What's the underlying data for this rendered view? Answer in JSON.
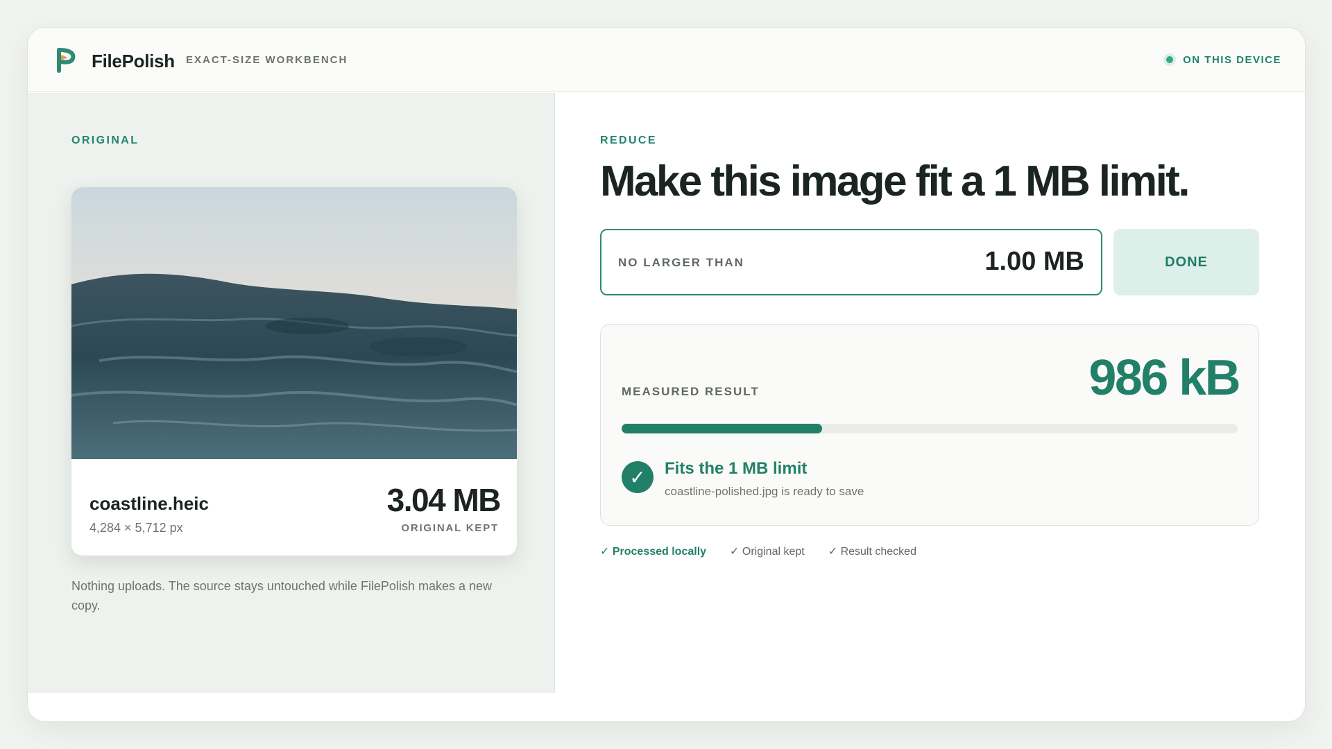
{
  "header": {
    "brand": "FilePolish",
    "subtitle": "EXACT-SIZE WORKBENCH",
    "status": "ON THIS DEVICE"
  },
  "original": {
    "eyebrow": "ORIGINAL",
    "filename": "coastline.heic",
    "dimensions": "4,284 × 5,712 px",
    "size": "3.04 MB",
    "size_label": "ORIGINAL KEPT",
    "note": "Nothing uploads. The source stays untouched while FilePolish makes a new copy."
  },
  "reduce": {
    "eyebrow": "REDUCE",
    "headline": "Make this image fit a 1 MB limit.",
    "limit_label": "NO LARGER THAN",
    "limit_value": "1.00 MB",
    "done_label": "DONE",
    "measured_label": "MEASURED RESULT",
    "measured_value": "986 kB",
    "progress_fraction": 0.325,
    "fits_title": "Fits the 1 MB limit",
    "fits_detail": "coastline-polished.jpg is ready to save",
    "badges": [
      "✓ Processed locally",
      "✓ Original kept",
      "✓ Result checked"
    ]
  },
  "colors": {
    "accent": "#228069",
    "accent_soft": "#dcefe8",
    "left_panel": "#eef2ee"
  },
  "icons": {
    "logo": "filepolish-logo-icon",
    "status": "status-dot-icon",
    "success": "check-circle-icon"
  }
}
